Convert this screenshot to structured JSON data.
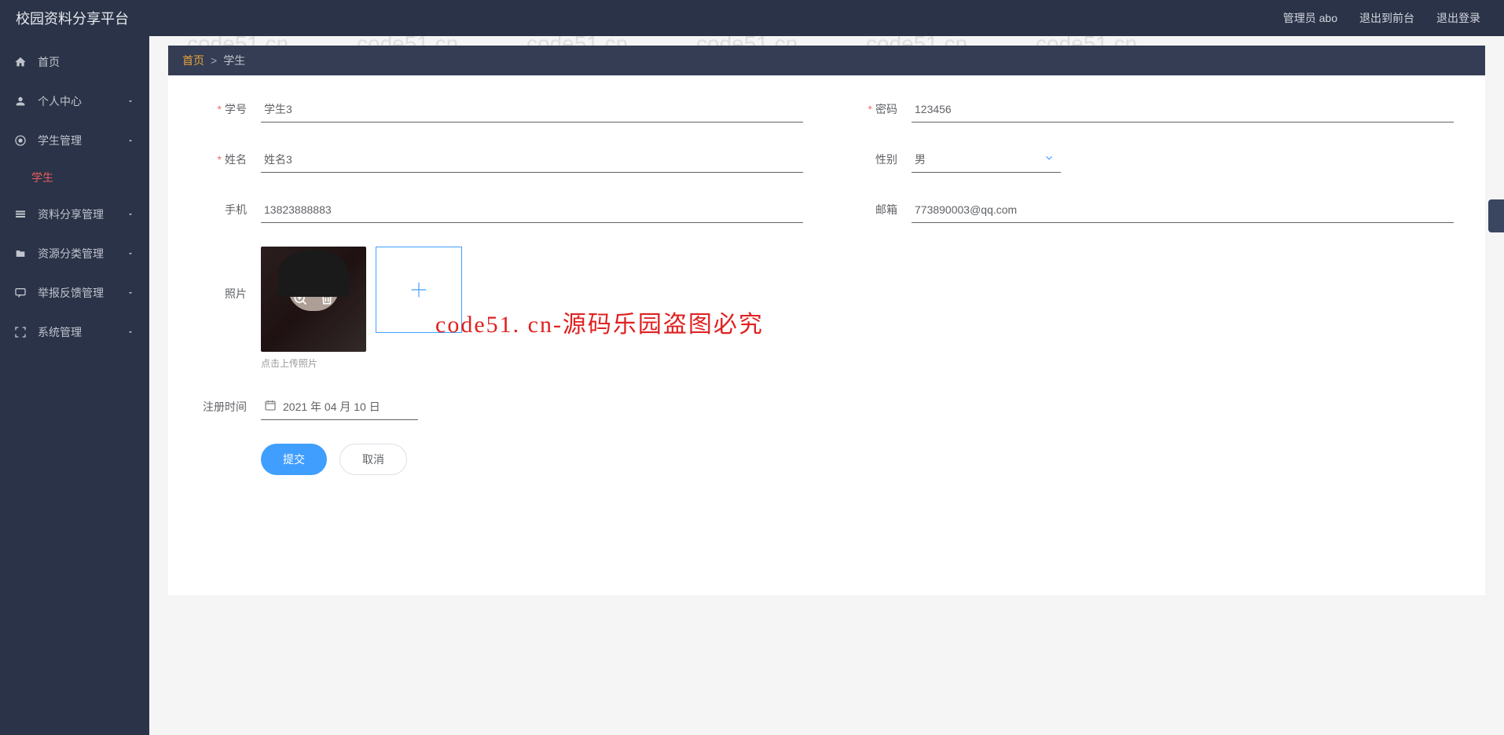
{
  "header": {
    "title": "校园资料分享平台",
    "admin_label": "管理员 abo",
    "logout_front": "退出到前台",
    "logout": "退出登录"
  },
  "sidebar": {
    "items": [
      {
        "label": "首页",
        "icon": "home"
      },
      {
        "label": "个人中心",
        "icon": "user",
        "expandable": true
      },
      {
        "label": "学生管理",
        "icon": "circle",
        "expandable": true,
        "expanded": true
      },
      {
        "label": "资料分享管理",
        "icon": "layers",
        "expandable": true
      },
      {
        "label": "资源分类管理",
        "icon": "folder",
        "expandable": true
      },
      {
        "label": "举报反馈管理",
        "icon": "chat",
        "expandable": true
      },
      {
        "label": "系统管理",
        "icon": "fullscreen",
        "expandable": true
      }
    ],
    "submenu_active": "学生"
  },
  "breadcrumb": {
    "home": "首页",
    "current": "学生"
  },
  "form": {
    "student_id": {
      "label": "学号",
      "value": "学生3",
      "required": true
    },
    "password": {
      "label": "密码",
      "value": "123456",
      "required": true
    },
    "name": {
      "label": "姓名",
      "value": "姓名3",
      "required": true
    },
    "gender": {
      "label": "性别",
      "value": "男"
    },
    "phone": {
      "label": "手机",
      "value": "13823888883"
    },
    "email": {
      "label": "邮箱",
      "value": "773890003@qq.com"
    },
    "photo": {
      "label": "照片",
      "tip": "点击上传照片"
    },
    "reg_time": {
      "label": "注册时间",
      "value": "2021 年 04 月 10 日"
    }
  },
  "actions": {
    "submit": "提交",
    "cancel": "取消"
  },
  "overlay": "code51. cn-源码乐园盗图必究",
  "watermark_text": "code51.cn"
}
